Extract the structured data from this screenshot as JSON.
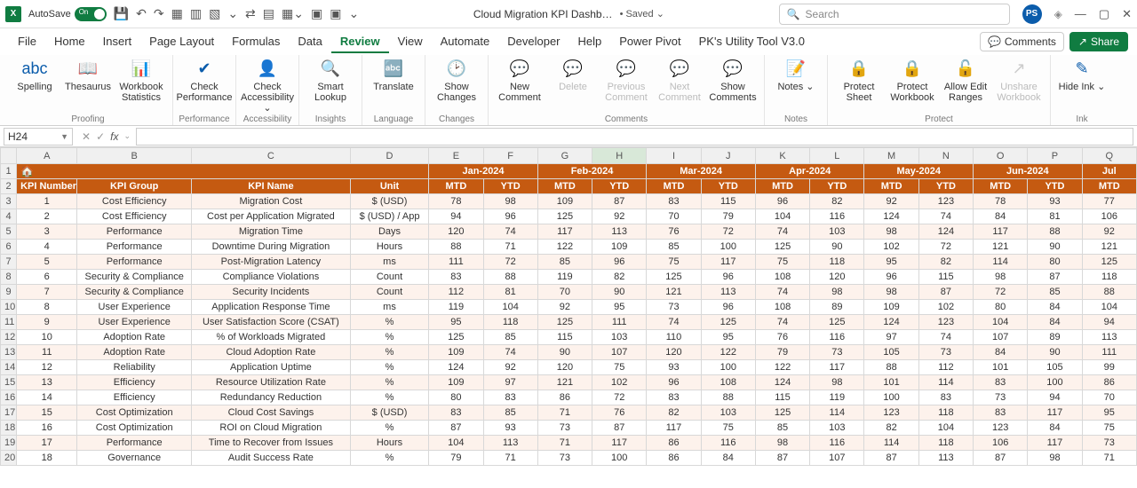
{
  "titlebar": {
    "autosave_label": "AutoSave",
    "autosave_on": "On",
    "doc_name": "Cloud Migration KPI Dashb…",
    "saved": "• Saved ⌄",
    "search_placeholder": "Search",
    "avatar_initials": "PS"
  },
  "menubar": {
    "tabs": [
      "File",
      "Home",
      "Insert",
      "Page Layout",
      "Formulas",
      "Data",
      "Review",
      "View",
      "Automate",
      "Developer",
      "Help",
      "Power Pivot",
      "PK's Utility Tool V3.0"
    ],
    "active": "Review",
    "comments": "Comments",
    "share": "Share"
  },
  "ribbon": {
    "groups": [
      {
        "label": "Proofing",
        "items": [
          {
            "icon": "abc",
            "text": "Spelling"
          },
          {
            "icon": "📖",
            "text": "Thesaurus"
          },
          {
            "icon": "📊",
            "text": "Workbook Statistics"
          }
        ]
      },
      {
        "label": "Performance",
        "items": [
          {
            "icon": "✔︎",
            "text": "Check Performance"
          }
        ]
      },
      {
        "label": "Accessibility",
        "items": [
          {
            "icon": "👤",
            "text": "Check Accessibility ⌄"
          }
        ]
      },
      {
        "label": "Insights",
        "items": [
          {
            "icon": "🔍",
            "text": "Smart Lookup"
          }
        ]
      },
      {
        "label": "Language",
        "items": [
          {
            "icon": "🔤",
            "text": "Translate"
          }
        ]
      },
      {
        "label": "Changes",
        "items": [
          {
            "icon": "🕑",
            "text": "Show Changes"
          }
        ]
      },
      {
        "label": "Comments",
        "items": [
          {
            "icon": "💬",
            "text": "New Comment"
          },
          {
            "icon": "💬",
            "text": "Delete",
            "disabled": true
          },
          {
            "icon": "💬",
            "text": "Previous Comment",
            "disabled": true
          },
          {
            "icon": "💬",
            "text": "Next Comment",
            "disabled": true
          },
          {
            "icon": "💬",
            "text": "Show Comments"
          }
        ]
      },
      {
        "label": "Notes",
        "items": [
          {
            "icon": "📝",
            "text": "Notes ⌄"
          }
        ]
      },
      {
        "label": "Protect",
        "items": [
          {
            "icon": "🔒",
            "text": "Protect Sheet"
          },
          {
            "icon": "🔒",
            "text": "Protect Workbook"
          },
          {
            "icon": "🔓",
            "text": "Allow Edit Ranges"
          },
          {
            "icon": "↗",
            "text": "Unshare Workbook",
            "disabled": true
          }
        ]
      },
      {
        "label": "Ink",
        "items": [
          {
            "icon": "✎",
            "text": "Hide Ink ⌄"
          }
        ]
      }
    ]
  },
  "namebox": "H24",
  "columns": [
    "A",
    "B",
    "C",
    "D",
    "E",
    "F",
    "G",
    "H",
    "I",
    "J",
    "K",
    "L",
    "M",
    "N",
    "O",
    "P",
    "Q"
  ],
  "months": [
    "Jan-2024",
    "Feb-2024",
    "Mar-2024",
    "Apr-2024",
    "May-2024",
    "Jun-2024",
    "Jul"
  ],
  "mtd": "MTD",
  "ytd": "YTD",
  "headers": {
    "kpi_num": "KPI Number",
    "kpi_group": "KPI Group",
    "kpi_name": "KPI Name",
    "unit": "Unit"
  },
  "rows": [
    {
      "n": 1,
      "g": "Cost Efficiency",
      "k": "Migration Cost",
      "u": "$ (USD)",
      "v": [
        78,
        98,
        109,
        87,
        83,
        115,
        96,
        82,
        92,
        123,
        78,
        93,
        77
      ]
    },
    {
      "n": 2,
      "g": "Cost Efficiency",
      "k": "Cost per Application Migrated",
      "u": "$ (USD) / App",
      "v": [
        94,
        96,
        125,
        92,
        70,
        79,
        104,
        116,
        124,
        74,
        84,
        81,
        106
      ]
    },
    {
      "n": 3,
      "g": "Performance",
      "k": "Migration Time",
      "u": "Days",
      "v": [
        120,
        74,
        117,
        113,
        76,
        72,
        74,
        103,
        98,
        124,
        117,
        88,
        92
      ]
    },
    {
      "n": 4,
      "g": "Performance",
      "k": "Downtime During Migration",
      "u": "Hours",
      "v": [
        88,
        71,
        122,
        109,
        85,
        100,
        125,
        90,
        102,
        72,
        121,
        90,
        121
      ]
    },
    {
      "n": 5,
      "g": "Performance",
      "k": "Post-Migration Latency",
      "u": "ms",
      "v": [
        111,
        72,
        85,
        96,
        75,
        117,
        75,
        118,
        95,
        82,
        114,
        80,
        125
      ]
    },
    {
      "n": 6,
      "g": "Security & Compliance",
      "k": "Compliance Violations",
      "u": "Count",
      "v": [
        83,
        88,
        119,
        82,
        125,
        96,
        108,
        120,
        96,
        115,
        98,
        87,
        118
      ]
    },
    {
      "n": 7,
      "g": "Security & Compliance",
      "k": "Security Incidents",
      "u": "Count",
      "v": [
        112,
        81,
        70,
        90,
        121,
        113,
        74,
        98,
        98,
        87,
        72,
        85,
        88
      ]
    },
    {
      "n": 8,
      "g": "User Experience",
      "k": "Application Response Time",
      "u": "ms",
      "v": [
        119,
        104,
        92,
        95,
        73,
        96,
        108,
        89,
        109,
        102,
        80,
        84,
        104
      ]
    },
    {
      "n": 9,
      "g": "User Experience",
      "k": "User Satisfaction Score (CSAT)",
      "u": "%",
      "v": [
        95,
        118,
        125,
        111,
        74,
        125,
        74,
        125,
        124,
        123,
        104,
        84,
        94
      ]
    },
    {
      "n": 10,
      "g": "Adoption Rate",
      "k": "% of Workloads Migrated",
      "u": "%",
      "v": [
        125,
        85,
        115,
        103,
        110,
        95,
        76,
        116,
        97,
        74,
        107,
        89,
        113
      ]
    },
    {
      "n": 11,
      "g": "Adoption Rate",
      "k": "Cloud Adoption Rate",
      "u": "%",
      "v": [
        109,
        74,
        90,
        107,
        120,
        122,
        79,
        73,
        105,
        73,
        84,
        90,
        111
      ]
    },
    {
      "n": 12,
      "g": "Reliability",
      "k": "Application Uptime",
      "u": "%",
      "v": [
        124,
        92,
        120,
        75,
        93,
        100,
        122,
        117,
        88,
        112,
        101,
        105,
        99
      ]
    },
    {
      "n": 13,
      "g": "Efficiency",
      "k": "Resource Utilization Rate",
      "u": "%",
      "v": [
        109,
        97,
        121,
        102,
        96,
        108,
        124,
        98,
        101,
        114,
        83,
        100,
        86
      ]
    },
    {
      "n": 14,
      "g": "Efficiency",
      "k": "Redundancy Reduction",
      "u": "%",
      "v": [
        80,
        83,
        86,
        72,
        83,
        88,
        115,
        119,
        100,
        83,
        73,
        94,
        70
      ]
    },
    {
      "n": 15,
      "g": "Cost Optimization",
      "k": "Cloud Cost Savings",
      "u": "$ (USD)",
      "v": [
        83,
        85,
        71,
        76,
        82,
        103,
        125,
        114,
        123,
        118,
        83,
        117,
        95
      ]
    },
    {
      "n": 16,
      "g": "Cost Optimization",
      "k": "ROI on Cloud Migration",
      "u": "%",
      "v": [
        87,
        93,
        73,
        87,
        117,
        75,
        85,
        103,
        82,
        104,
        123,
        84,
        75
      ]
    },
    {
      "n": 17,
      "g": "Performance",
      "k": "Time to Recover from Issues",
      "u": "Hours",
      "v": [
        104,
        113,
        71,
        117,
        86,
        116,
        98,
        116,
        114,
        118,
        106,
        117,
        73
      ]
    },
    {
      "n": 18,
      "g": "Governance",
      "k": "Audit Success Rate",
      "u": "%",
      "v": [
        79,
        71,
        73,
        100,
        86,
        84,
        87,
        107,
        87,
        113,
        87,
        98,
        71
      ]
    }
  ]
}
